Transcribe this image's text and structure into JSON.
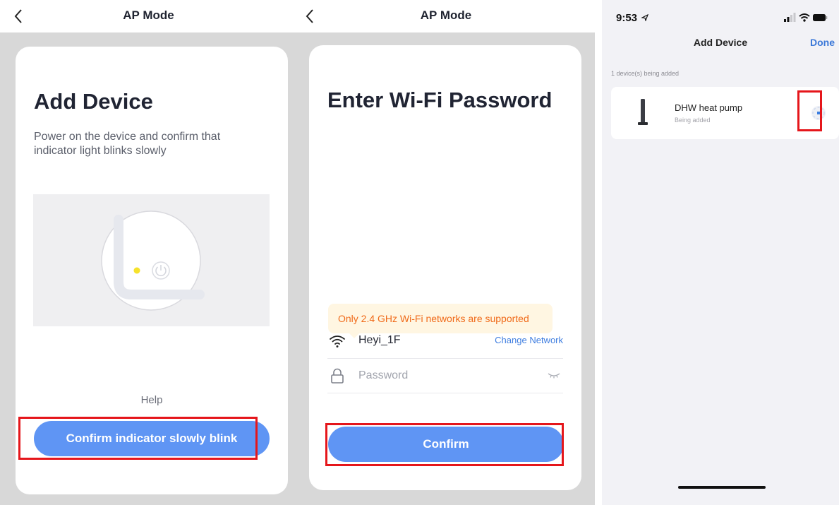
{
  "panel1": {
    "nav_title": "AP Mode",
    "title": "Add Device",
    "subtitle": "Power on the device and confirm that indicator light blinks slowly",
    "help_label": "Help",
    "confirm_label": "Confirm indicator slowly blink",
    "indicator_color": "#f6e22b"
  },
  "panel2": {
    "nav_title": "AP Mode",
    "title": "Enter Wi-Fi Password",
    "tip": "Only 2.4 GHz Wi-Fi networks are supported",
    "network_name": "Heyi_1F",
    "change_network_label": "Change Network",
    "password_placeholder": "Password",
    "password_value": "",
    "confirm_label": "Confirm"
  },
  "panel3": {
    "status_time": "9:53",
    "title": "Add Device",
    "done_label": "Done",
    "section_label": "1 device(s) being added",
    "device": {
      "name": "DHW heat pump",
      "status": "Being added"
    }
  },
  "colors": {
    "primary_button": "#5f95f4",
    "highlight_box": "#e5161b",
    "tip_text": "#f06a19",
    "link": "#3f7ee0",
    "ios_link": "#3b78d8"
  },
  "icons": {
    "back": "chevron-left-icon",
    "wifi": "wifi-icon",
    "lock": "lock-icon",
    "eye": "eye-closed-icon",
    "power": "power-icon",
    "device": "heat-pump-icon",
    "spinner": "loading-spinner-icon",
    "location": "location-arrow-icon",
    "signal": "cellular-signal-icon",
    "battery": "battery-icon"
  }
}
